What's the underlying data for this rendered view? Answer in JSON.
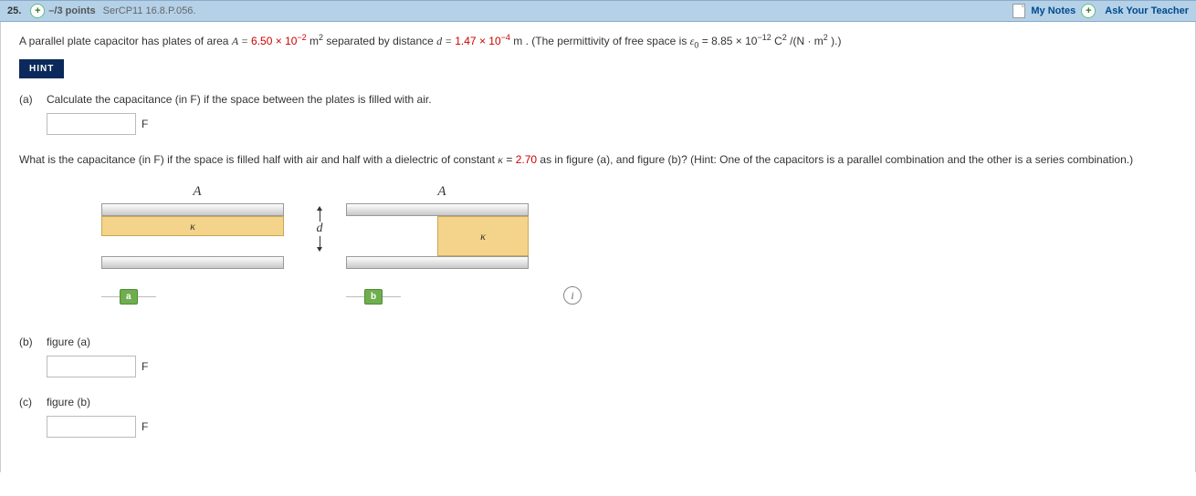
{
  "header": {
    "number": "25.",
    "points": "–/3 points",
    "problem_id": "SerCP11 16.8.P.056.",
    "my_notes": "My Notes",
    "ask_teacher": "Ask Your Teacher"
  },
  "problem": {
    "intro_pre": "A parallel plate capacitor has plates of area ",
    "A_eq": "A = ",
    "A_val": "6.50 × 10",
    "A_exp": "−2",
    "A_unit_pre": " m",
    "A_unit_sup": "2",
    "intro_mid": " separated by distance ",
    "d_eq": "d = ",
    "d_val": "1.47 × 10",
    "d_exp": "−4",
    "d_unit": " m",
    "intro_post1": ". (The permittivity of free space is ",
    "eps_sym": "ε",
    "eps_sub": "0",
    "eps_eq": " = ",
    "eps_val": "8.85 × 10",
    "eps_exp": "−12",
    "eps_unit1": " C",
    "eps_unit1_sup": "2",
    "eps_unit2": "/(N · m",
    "eps_unit2_sup": "2",
    "eps_unit3": ").)",
    "hint": "HINT",
    "part_a_label": "(a)",
    "part_a_text": "Calculate the capacitance (in F) if the space between the plates is filled with air.",
    "unit_F": "F",
    "para2_pre": "What is the capacitance (in F) if the space is filled half with air and half with a dielectric of constant ",
    "kappa_sym": "κ",
    "kappa_eq": " = ",
    "kappa_val": "2.70",
    "para2_post": " as in figure (a), and figure (b)? (Hint: One of the capacitors is a parallel combination and the other is a series combination.)",
    "fig_A": "A",
    "fig_kappa": "κ",
    "fig_d": "d",
    "fig_tag_a": "a",
    "fig_tag_b": "b",
    "part_b_label": "(b)",
    "part_b_text": "figure (a)",
    "part_c_label": "(c)",
    "part_c_text": "figure (b)"
  }
}
